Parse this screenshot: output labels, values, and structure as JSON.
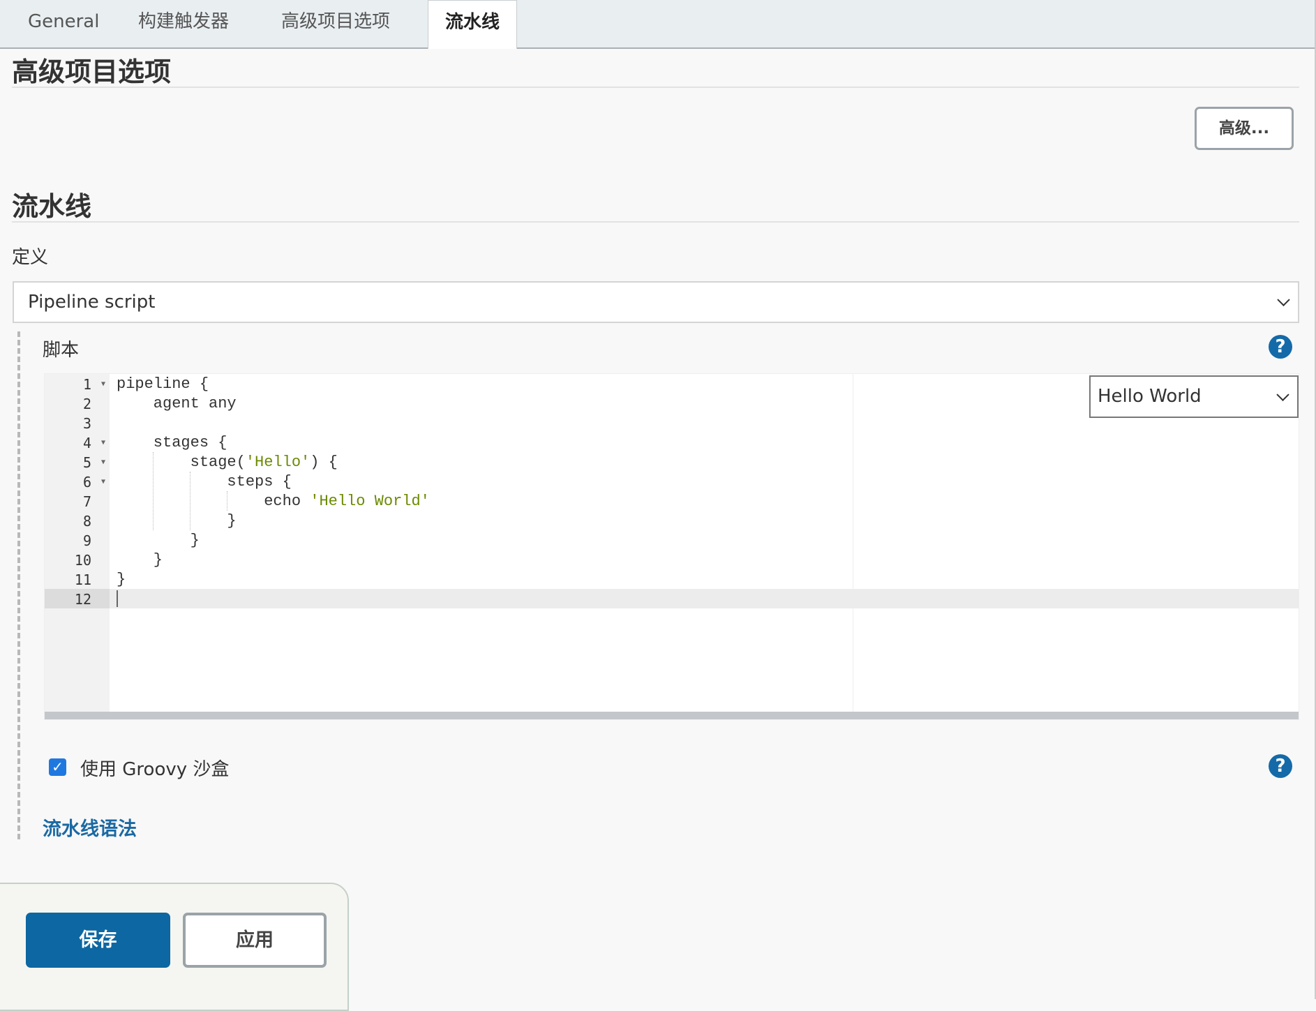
{
  "tabs": [
    {
      "label": "General"
    },
    {
      "label": "构建触发器"
    },
    {
      "label": "高级项目选项"
    },
    {
      "label": "流水线",
      "active": true
    }
  ],
  "advanced": {
    "title": "高级项目选项",
    "button": "高级..."
  },
  "pipeline": {
    "title": "流水线",
    "definition_label": "定义",
    "definition_value": "Pipeline script",
    "script_label": "脚本",
    "sample_select": "Hello World",
    "sandbox_label": "使用 Groovy 沙盒",
    "sandbox_checked": true,
    "syntax_link": "流水线语法"
  },
  "editor": {
    "lines": [
      {
        "num": "1",
        "code": "pipeline {",
        "str": "",
        "tail": ""
      },
      {
        "num": "2",
        "code": "    agent any",
        "str": "",
        "tail": ""
      },
      {
        "num": "3",
        "code": "",
        "str": "",
        "tail": ""
      },
      {
        "num": "4",
        "code": "    stages {",
        "str": "",
        "tail": ""
      },
      {
        "num": "5",
        "code": "        stage(",
        "str": "'Hello'",
        "tail": ") {"
      },
      {
        "num": "6",
        "code": "            steps {",
        "str": "",
        "tail": ""
      },
      {
        "num": "7",
        "code": "                echo ",
        "str": "'Hello World'",
        "tail": ""
      },
      {
        "num": "8",
        "code": "            }",
        "str": "",
        "tail": ""
      },
      {
        "num": "9",
        "code": "        }",
        "str": "",
        "tail": ""
      },
      {
        "num": "10",
        "code": "    }",
        "str": "",
        "tail": ""
      },
      {
        "num": "11",
        "code": "}",
        "str": "",
        "tail": ""
      },
      {
        "num": "12",
        "code": "",
        "str": "",
        "tail": ""
      }
    ],
    "active_line": 12
  },
  "footer": {
    "save": "保存",
    "apply": "应用"
  },
  "colors": {
    "primary": "#0d67a2",
    "help": "#146aa8",
    "string": "#6b8a00"
  },
  "icons": {
    "help": "question-circle-icon",
    "fold": "fold-triangle-icon",
    "chevron": "chevron-down-icon",
    "check": "checkmark-icon"
  }
}
